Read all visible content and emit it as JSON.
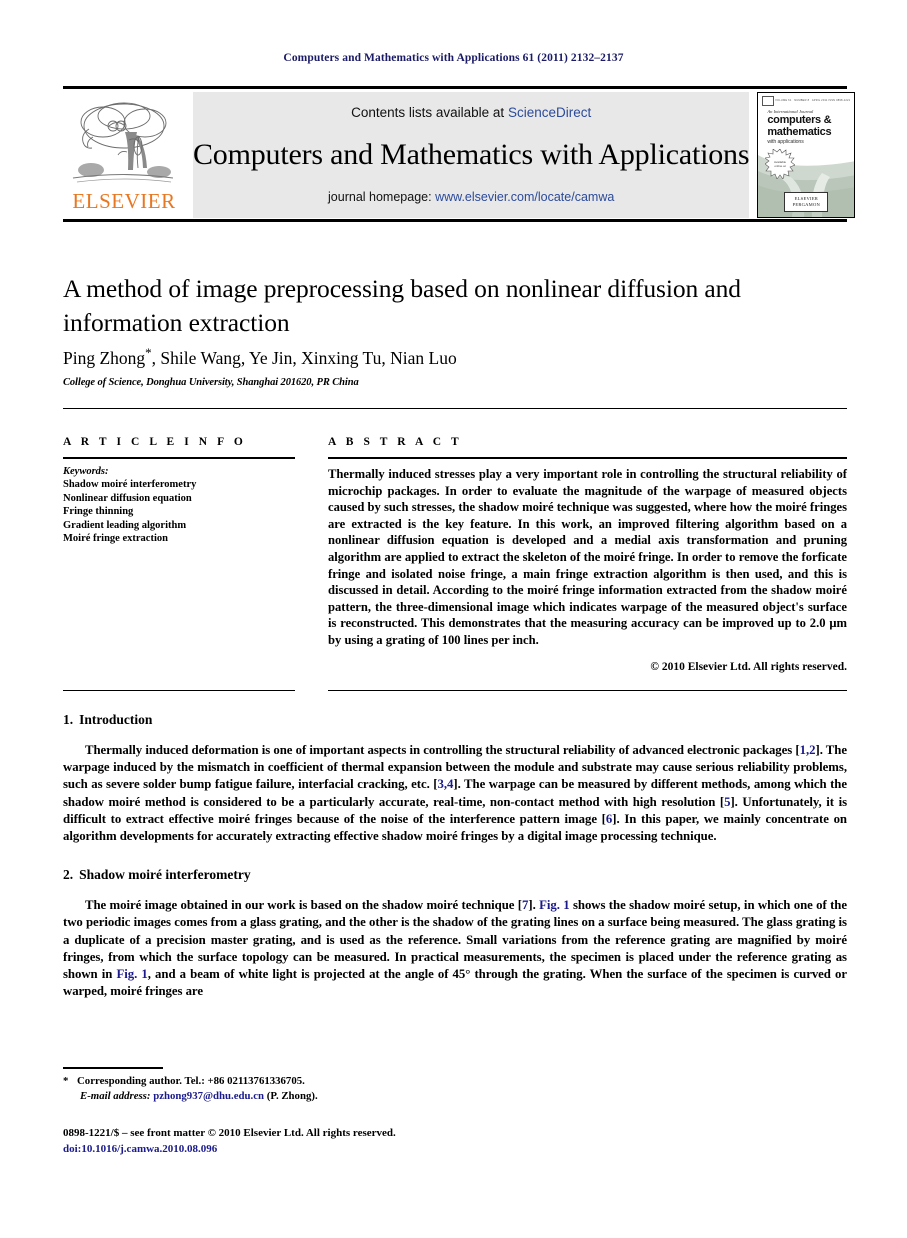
{
  "running_head": "Computers and Mathematics with Applications 61 (2011) 2132–2137",
  "masthead": {
    "contents_prefix": "Contents lists available at ",
    "contents_link": "ScienceDirect",
    "journal_title": "Computers and Mathematics with Applications",
    "homepage_prefix": "journal homepage: ",
    "homepage_link": "www.elsevier.com/locate/camwa",
    "publisher_wordmark": "ELSEVIER",
    "accent_orange": "#E87722",
    "link_blue": "#2b4a9b",
    "banner_bg": "#e8e8e8"
  },
  "cover": {
    "kicker": "An International Journal",
    "line1": "computers &",
    "line2": "mathematics",
    "line3": "with applications",
    "editors": "Editors-in-Chief: Ervin Y. Rodin\nAssociate Editors: Leopoldo P. Franca, Xiaolin Hu",
    "imprint_line1": "ELSEVIER",
    "imprint_line2": "PERGAMON"
  },
  "article": {
    "title": "A method of image preprocessing based on nonlinear diffusion and information extraction",
    "authors": "Ping Zhong, Shile Wang, Ye Jin, Xinxing Tu, Nian Luo",
    "corresponding_marker": "*",
    "affiliation": "College of Science, Donghua University, Shanghai 201620, PR China"
  },
  "info": {
    "heading": "A R T I C L E    I N F O",
    "keywords_heading": "Keywords:",
    "keywords": [
      "Shadow moiré interferometry",
      "Nonlinear diffusion equation",
      "Fringe thinning",
      "Gradient leading algorithm",
      "Moiré fringe extraction"
    ]
  },
  "abstract": {
    "heading": "A B S T R A C T",
    "text": "Thermally induced stresses play a very important role in controlling the structural reliability of microchip packages. In order to evaluate the magnitude of the warpage of measured objects caused by such stresses, the shadow moiré technique was suggested, where how the moiré fringes are extracted is the key feature. In this work, an improved filtering algorithm based on a nonlinear diffusion equation is developed and a medial axis transformation and pruning algorithm are applied to extract the skeleton of the moiré fringe. In order to remove the forficate fringe and isolated noise fringe, a main fringe extraction algorithm is then used, and this is discussed in detail. According to the moiré fringe information extracted from the shadow moiré pattern, the three-dimensional image which indicates warpage of the measured object's surface is reconstructed. This demonstrates that the measuring accuracy can be improved up to 2.0 μm by using a grating of 100 lines per inch.",
    "copyright": "© 2010 Elsevier Ltd. All rights reserved."
  },
  "sections": [
    {
      "number": "1.",
      "title": "Introduction",
      "paragraphs": [
        [
          {
            "t": "Thermally induced deformation is one of important aspects in controlling the structural reliability of advanced electronic packages ["
          },
          {
            "t": "1,2",
            "cite": true
          },
          {
            "t": "]. The warpage induced by the mismatch in coefficient of thermal expansion between the module and substrate may cause serious reliability problems, such as severe solder bump fatigue failure, interfacial cracking, etc. ["
          },
          {
            "t": "3,4",
            "cite": true
          },
          {
            "t": "]. The warpage can be measured by different methods, among which the shadow moiré method is considered to be a particularly accurate, real-time, non-contact method with high resolution ["
          },
          {
            "t": "5",
            "cite": true
          },
          {
            "t": "]. Unfortunately, it is difficult to extract effective moiré fringes because of the noise of the interference pattern image ["
          },
          {
            "t": "6",
            "cite": true
          },
          {
            "t": "]. In this paper, we mainly concentrate on algorithm developments for accurately extracting effective shadow moiré fringes by a digital image processing technique."
          }
        ]
      ]
    },
    {
      "number": "2.",
      "title": "Shadow moiré interferometry",
      "paragraphs": [
        [
          {
            "t": "The moiré image obtained in our work is based on the shadow moiré technique ["
          },
          {
            "t": "7",
            "cite": true
          },
          {
            "t": "]. "
          },
          {
            "t": "Fig. 1",
            "cite": true
          },
          {
            "t": " shows the shadow moiré setup, in which one of the two periodic images comes from a glass grating, and the other is the shadow of the grating lines on a surface being measured. The glass grating is a duplicate of a precision master grating, and is used as the reference. Small variations from the reference grating are magnified by moiré fringes, from which the surface topology can be measured. In practical measurements, the specimen is placed under the reference grating as shown in "
          },
          {
            "t": "Fig. 1",
            "cite": true
          },
          {
            "t": ", and a beam of white light is projected at the angle of 45° through the grating. When the surface of the specimen is curved or warped, moiré fringes are"
          }
        ]
      ]
    }
  ],
  "footnote": {
    "marker": "*",
    "corresponding": "Corresponding author. Tel.: +86 02113761336705.",
    "email_label": "E-mail address:",
    "email": "pzhong937@dhu.edu.cn",
    "email_suffix": "(P. Zhong)."
  },
  "imprint": {
    "front_matter": "0898-1221/$ – see front matter © 2010 Elsevier Ltd. All rights reserved.",
    "doi": "doi:10.1016/j.camwa.2010.08.096"
  }
}
